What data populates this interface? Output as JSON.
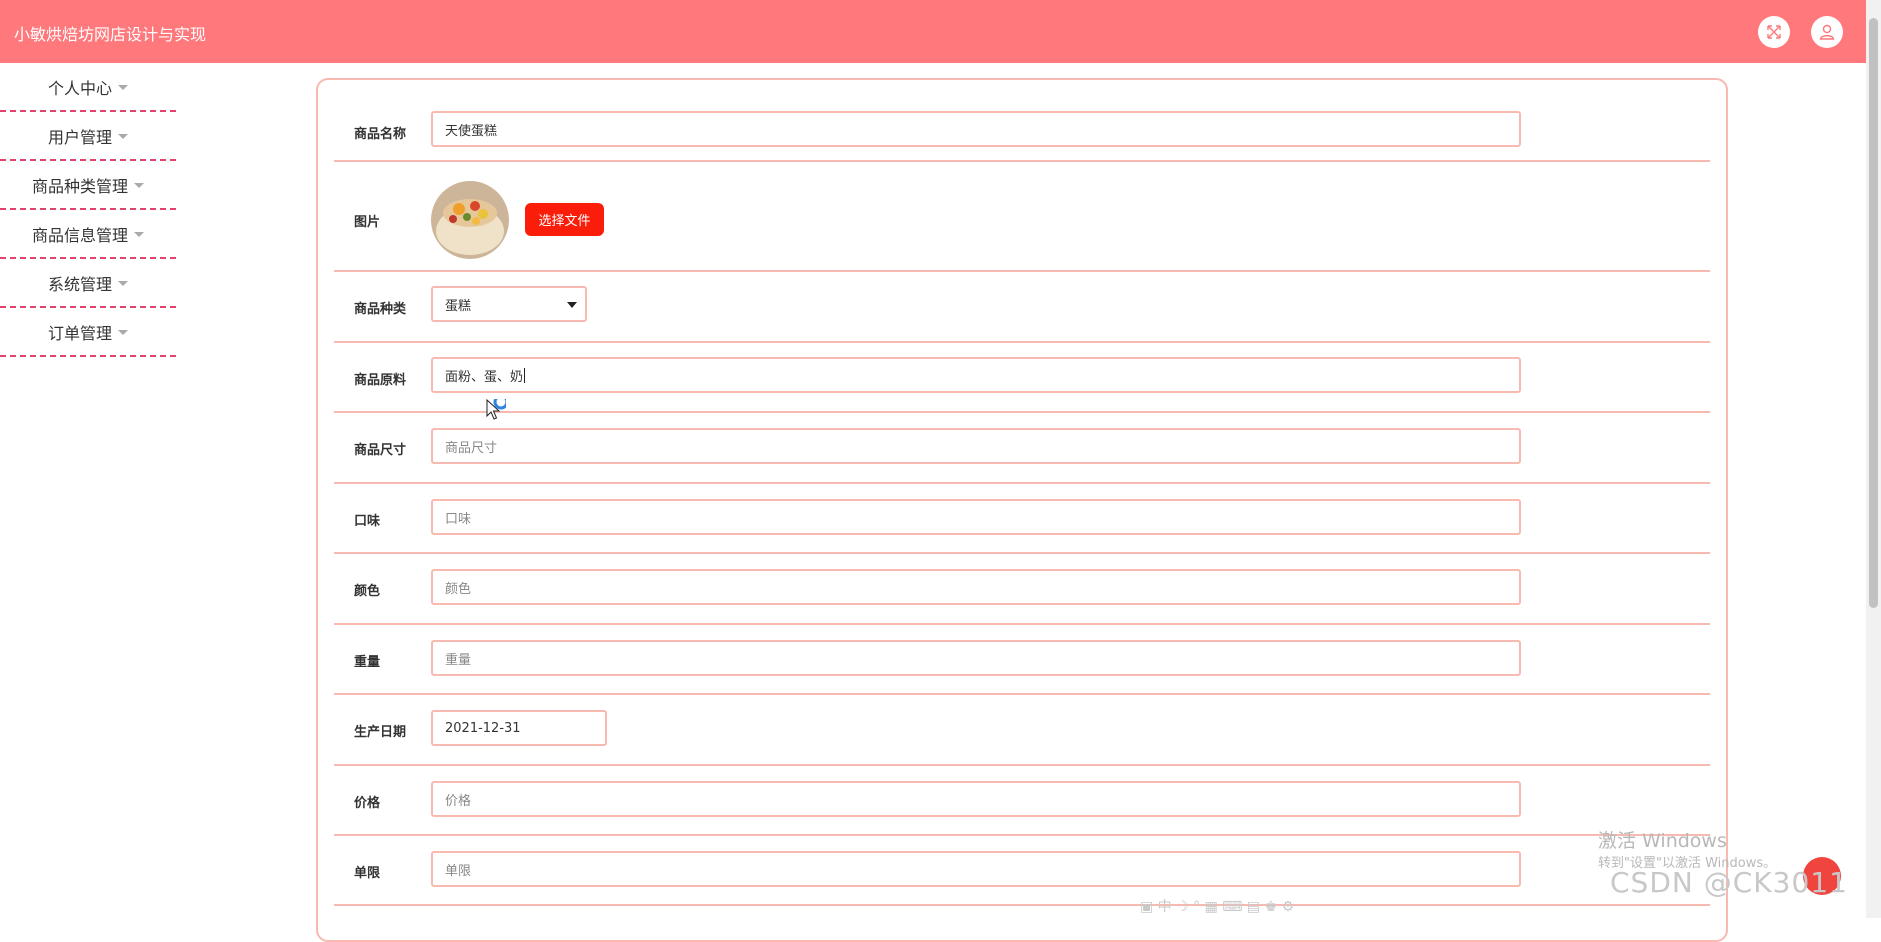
{
  "app": {
    "title": "小敏烘焙坊网店设计与实现"
  },
  "header": {
    "icons": [
      "fullscreen-icon",
      "user-icon"
    ]
  },
  "sidebar": {
    "items": [
      {
        "label": "个人中心"
      },
      {
        "label": "用户管理"
      },
      {
        "label": "商品种类管理"
      },
      {
        "label": "商品信息管理"
      },
      {
        "label": "系统管理"
      },
      {
        "label": "订单管理"
      }
    ]
  },
  "form": {
    "name": {
      "label": "商品名称",
      "value": "天使蛋糕"
    },
    "image": {
      "label": "图片",
      "button": "选择文件"
    },
    "category": {
      "label": "商品种类",
      "value": "蛋糕"
    },
    "ingredients": {
      "label": "商品原料",
      "value": "面粉、蛋、奶"
    },
    "size": {
      "label": "商品尺寸",
      "placeholder": "商品尺寸"
    },
    "flavor": {
      "label": "口味",
      "placeholder": "口味"
    },
    "color": {
      "label": "颜色",
      "placeholder": "颜色"
    },
    "weight": {
      "label": "重量",
      "placeholder": "重量"
    },
    "production_date": {
      "label": "生产日期",
      "value": "2021-12-31"
    },
    "price": {
      "label": "价格",
      "placeholder": "价格"
    },
    "limit": {
      "label": "单限",
      "placeholder": "单限"
    }
  },
  "overlay": {
    "windows_activate": "激活 Windows",
    "windows_hint": "转到\"设置\"以激活 Windows。",
    "csdn": "CSDN @CK3011"
  },
  "colors": {
    "header_bg": "#ff787c",
    "border": "#f7b9b0",
    "button": "#fa1e0a",
    "sidebar_divider": "#e0436b"
  }
}
